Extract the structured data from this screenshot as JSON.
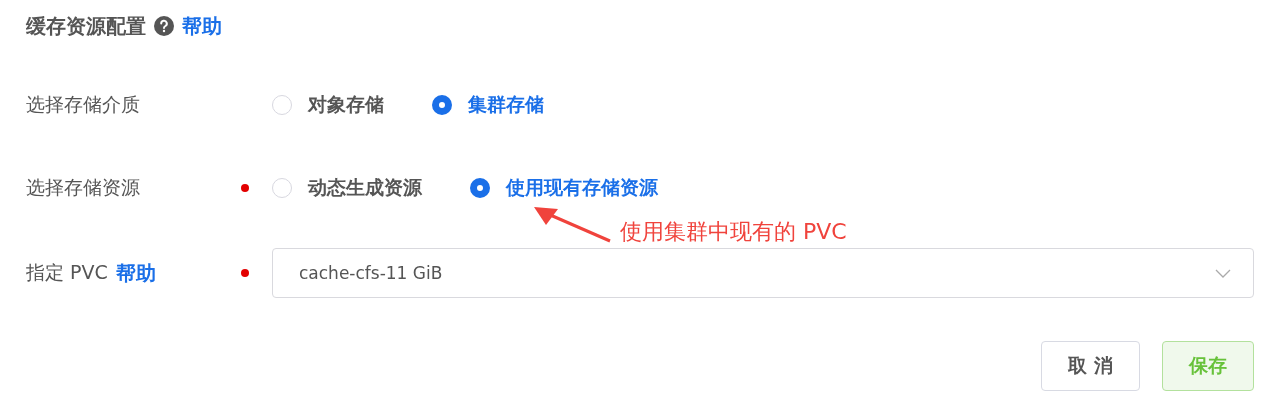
{
  "section": {
    "title": "缓存资源配置",
    "help_link": "帮助"
  },
  "rows": [
    {
      "kind": "radio",
      "label": "选择存储介质",
      "required": false,
      "options": [
        {
          "label": "对象存储",
          "selected": false
        },
        {
          "label": "集群存储",
          "selected": true
        }
      ]
    },
    {
      "kind": "radio",
      "label": "选择存储资源",
      "required": true,
      "options": [
        {
          "label": "动态生成资源",
          "selected": false
        },
        {
          "label": "使用现有存储资源",
          "selected": true
        }
      ]
    },
    {
      "kind": "select",
      "label": "指定 PVC",
      "help_link": "帮助",
      "required": true,
      "value": "cache-cfs-11 GiB"
    }
  ],
  "annotation": {
    "text": "使用集群中现有的 PVC"
  },
  "buttons": [
    {
      "label": "取 消",
      "kind": "default"
    },
    {
      "label": "保存",
      "kind": "primary"
    }
  ]
}
